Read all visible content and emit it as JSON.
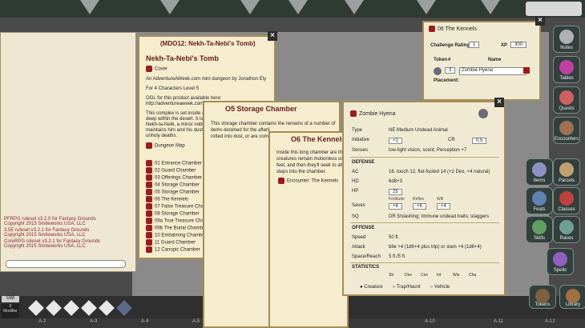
{
  "app": {
    "gm_label": "GM",
    "modifier_label": "Modifier",
    "modifier_value": "0"
  },
  "legal": [
    "PFRPG ruleset v3.2.0 for Fantasy Grounds",
    "Copyright 2015 Smiteworks USA, LLC",
    "3.5E ruleset v3.2.1 for Fantasy Grounds",
    "Copyright 2015 Smiteworks USA, LLC",
    "CoreRPG ruleset v3.2.1 for Fantasy Grounds",
    "Copyright 2015 Smiteworks USA, LLC"
  ],
  "sidebar": [
    "Notes",
    "Tables",
    "Quests",
    "Encounters",
    "Items",
    "Parcels",
    "Feats",
    "Classes",
    "Skills",
    "Races",
    "Spells",
    "Tokens",
    "Library"
  ],
  "rulers": [
    "A-2",
    "A-3",
    "A-4",
    "A-5",
    "A-10",
    "A-11",
    "A-12"
  ],
  "module": {
    "title_bar": "(MDO12: Nekh-Ta-Nebi's Tomb)",
    "heading": "Nekh-Ta-Nebi's Tomb",
    "cover": "Cover",
    "line1": "An AdventureAWeek.com mini dungeon by Jonathon Ely",
    "line2": "For 4 Characters Level 5",
    "ogl1": "OGL for this product available here:",
    "ogl2": "http://adventureaweek.com/",
    "body1": "This complex is set inside a",
    "body2": "deep within the desert. It is",
    "body3": "Nekh-ta-Nebi, a minor noble",
    "body4": "maintains him and his dusty",
    "body5": "unholy deaths.",
    "map_link": "Dungeon Map",
    "links": [
      "01 Entrance Chamber",
      "02 Guard Chamber",
      "03 Offerings Chamber",
      "04 Storage Chamber",
      "05 Storage Chamber",
      "06 The Kennels",
      "07 False Treasure Cham",
      "08 Storage Chamber",
      "09a True Treasure Cham",
      "09b The Burial Chamber",
      "10 Embalming Chamber",
      "11 Guard Chamber",
      "12 Canopic Chamber"
    ]
  },
  "storage": {
    "title": "O5 Storage Chamber",
    "text1": "This storage chamber contains the remains of a number of",
    "text2": "items destined for the afterli",
    "text3": "rotted into dust, or are comp"
  },
  "kennels": {
    "title": "O6 The Kennels",
    "text1": "Inside this long chamber are thre",
    "text2": "creatures remain motionless unt",
    "text3": "feet, and then they'll seek to atta",
    "text4": "steps into the chamber.",
    "encounter": "Encounter: The Kennels"
  },
  "encounter": {
    "title": "06 The Kennels",
    "cr_label": "Challenge Rating",
    "cr_value": "1",
    "xp_label": "XP",
    "xp_value": "300",
    "token_label": "Token",
    "count_label": "#",
    "name_label": "Name",
    "count": "3",
    "npc_name": "Zombie Hyena",
    "placement_label": "Placement:"
  },
  "npc": {
    "name": "Zombie Hyena",
    "type_label": "Type",
    "type": "NE Medium Undead Animal",
    "init_label": "Initiative",
    "init": "+2",
    "cr_label": "CR",
    "cr": "0.5",
    "senses_label": "Senses",
    "senses": "low-light vision, scent; Perception +7",
    "defense": "DEFENSE",
    "ac_label": "AC",
    "ac": "16, touch 12, flat-footed 14 (+2 Dex, +4 natural)",
    "hd_label": "HD",
    "hd": "6d8+3",
    "hp_label": "HP",
    "hp": "25",
    "saves_label": "Saves",
    "fort_label": "Fortitude",
    "fort": "+8",
    "ref_label": "Reflex",
    "ref": "+6",
    "will_label": "Will",
    "will": "+4",
    "sq_label": "SQ",
    "sq": "DR 5/slashing; Immune undead traits; staggers",
    "offense": "OFFENSE",
    "speed_label": "Speed",
    "speed": "50 ft.",
    "attack_label": "Attack",
    "attack": "bite +4 (1d6+4 plus trip) or slam +4 (1d6+4)",
    "space_label": "Space/Reach",
    "space": "5 ft./5 ft.",
    "statistics": "STATISTICS",
    "abilities": [
      "Str",
      "Dex",
      "Con",
      "Int",
      "Wis",
      "Cha"
    ],
    "radio": [
      "Creature",
      "Trap/Haunt",
      "Vehicle"
    ]
  }
}
